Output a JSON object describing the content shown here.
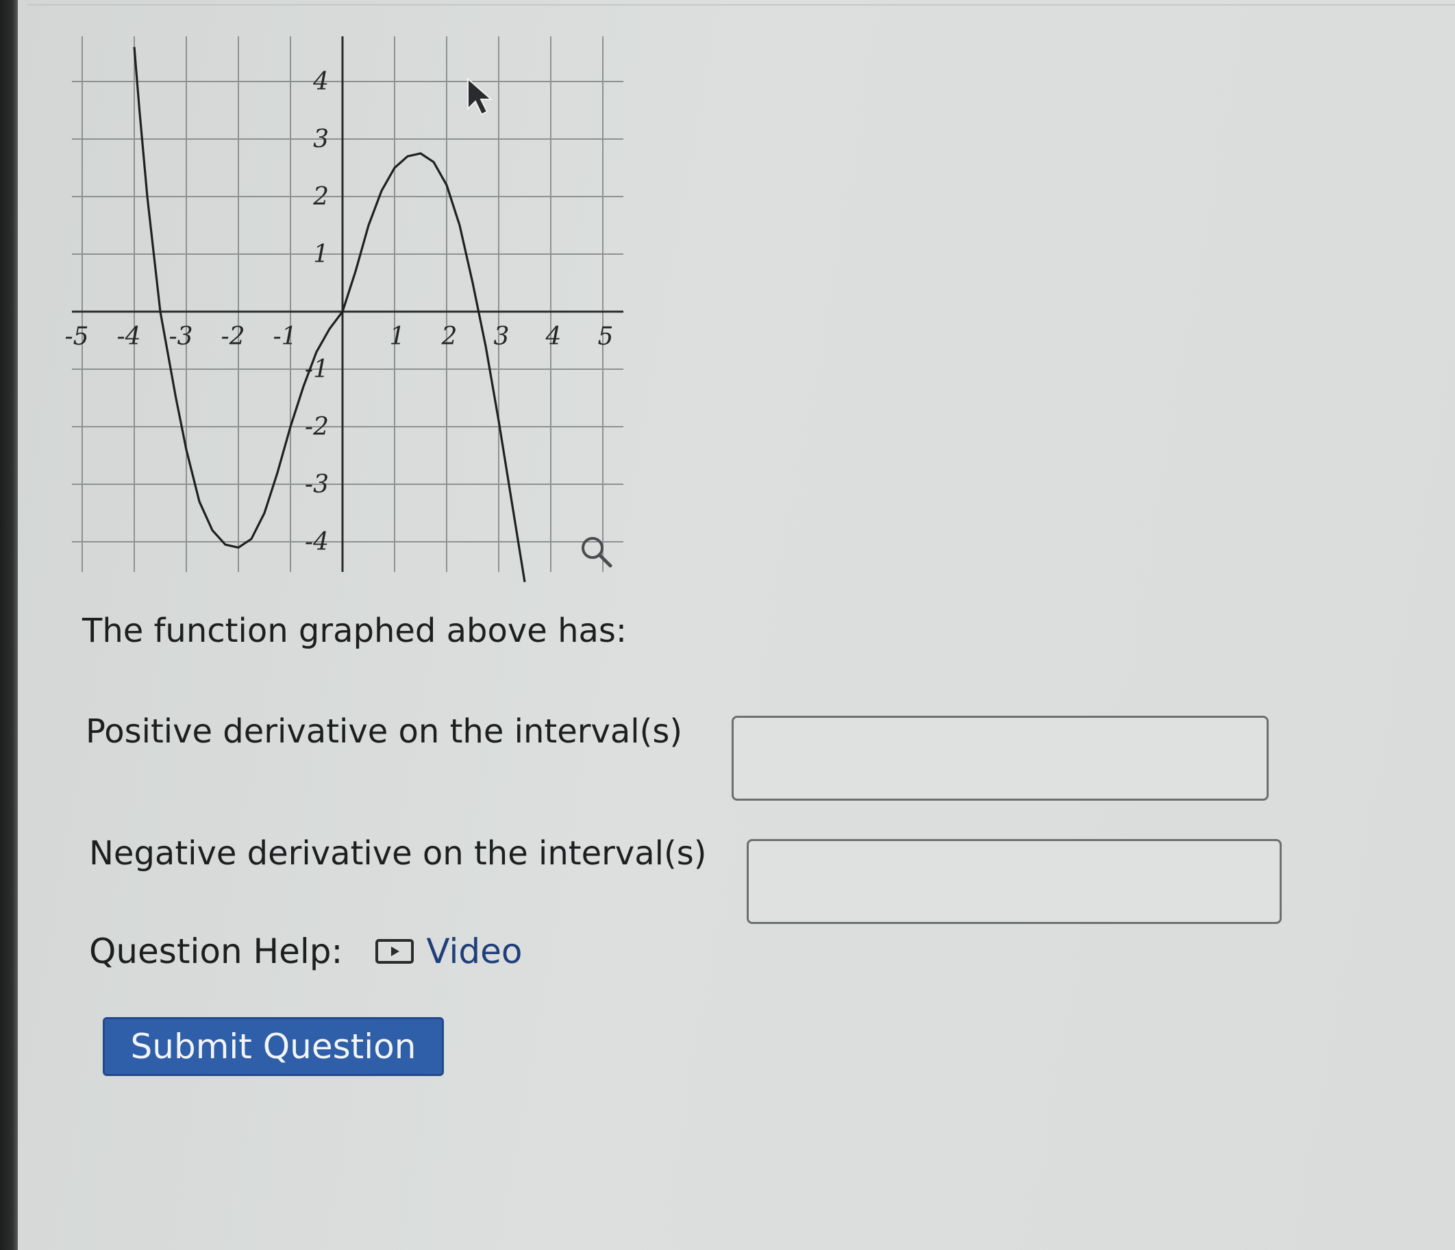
{
  "question": {
    "intro": "The function graphed above has:",
    "positive_label": "Positive derivative on the interval(s)",
    "positive_value": "",
    "negative_label": "Negative derivative on the interval(s)",
    "negative_value": ""
  },
  "help": {
    "label": "Question Help:",
    "video_label": "Video",
    "video_icon": "play-icon"
  },
  "submit": {
    "label": "Submit Question"
  },
  "graph": {
    "x_ticks": [
      "-5",
      "-4",
      "-3",
      "-2",
      "-1",
      "1",
      "2",
      "3",
      "4",
      "5"
    ],
    "y_ticks": [
      "4",
      "3",
      "2",
      "1",
      "-1",
      "-2",
      "-3",
      "-4"
    ],
    "icons": [
      "magnify-icon",
      "cursor-icon"
    ]
  },
  "chart_data": {
    "type": "line",
    "xlim": [
      -5,
      5
    ],
    "ylim": [
      -4.5,
      4.5
    ],
    "grid": true,
    "x_ticks": [
      -5,
      -4,
      -3,
      -2,
      -1,
      1,
      2,
      3,
      4,
      5
    ],
    "y_ticks": [
      -4,
      -3,
      -2,
      -1,
      1,
      2,
      3,
      4
    ],
    "series": [
      {
        "points": [
          [
            -4,
            4.6
          ],
          [
            -3.9,
            3.5
          ],
          [
            -3.75,
            2.0
          ],
          [
            -3.5,
            0.0
          ],
          [
            -3.2,
            -1.5
          ],
          [
            -3.0,
            -2.4
          ],
          [
            -2.75,
            -3.3
          ],
          [
            -2.5,
            -3.8
          ],
          [
            -2.25,
            -4.05
          ],
          [
            -2.0,
            -4.1
          ],
          [
            -1.75,
            -3.95
          ],
          [
            -1.5,
            -3.5
          ],
          [
            -1.25,
            -2.8
          ],
          [
            -1.0,
            -2.0
          ],
          [
            -0.75,
            -1.3
          ],
          [
            -0.5,
            -0.7
          ],
          [
            -0.25,
            -0.3
          ],
          [
            0.0,
            0.0
          ],
          [
            0.25,
            0.7
          ],
          [
            0.5,
            1.5
          ],
          [
            0.75,
            2.1
          ],
          [
            1.0,
            2.5
          ],
          [
            1.25,
            2.7
          ],
          [
            1.5,
            2.75
          ],
          [
            1.75,
            2.6
          ],
          [
            2.0,
            2.2
          ],
          [
            2.25,
            1.5
          ],
          [
            2.5,
            0.5
          ],
          [
            2.75,
            -0.6
          ],
          [
            3.0,
            -1.9
          ],
          [
            3.25,
            -3.3
          ],
          [
            3.5,
            -4.7
          ]
        ]
      }
    ]
  }
}
